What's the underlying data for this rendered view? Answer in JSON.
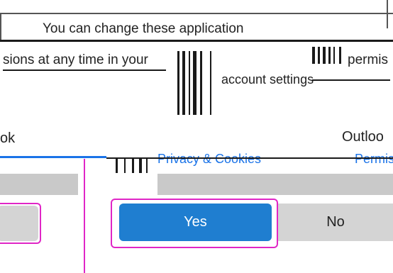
{
  "dialog": {
    "message_line1": "You can change these application",
    "message_line2_left": "sions at any time in your",
    "message_line2_right": "permis",
    "message_line3": "account settings",
    "left_app_fragment": "ok",
    "right_app_name": "Outloo",
    "privacy_link": "Privacy & Cookies",
    "permissions_link": "Permis",
    "yes_label": "Yes",
    "no_label": "No"
  },
  "colors": {
    "primary_button": "#1f7ed0",
    "secondary_button": "#d4d4d4",
    "highlight_outline": "#e026c6",
    "link": "#1a73e8"
  }
}
